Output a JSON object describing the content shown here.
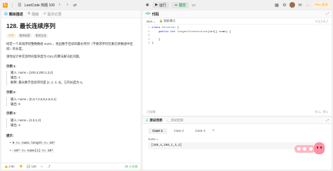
{
  "topbar": {
    "app_name": "LeetCode 热题 100",
    "submit_label": "提交",
    "run_label": "运行",
    "plus_label": "Plus 会员"
  },
  "left": {
    "tabs": [
      {
        "label": "题目描述",
        "icon": "document-icon"
      },
      {
        "label": "题解",
        "icon": "flask-icon"
      },
      {
        "label": "提交记录",
        "icon": "history-icon"
      }
    ],
    "title": "128. 最长连续序列",
    "chips": [
      {
        "label": "中等"
      },
      {
        "label": "相关标签"
      },
      {
        "label": "相关企业"
      }
    ],
    "desc1": "给定一个未排序的整数数组 nums ，找出数字连续的最长序列（不要求序列元素在原数组中连续）的长度。",
    "desc2": "请你设计并实现时间复杂度为 O(n) 的算法解决此问题。",
    "examples": [
      {
        "title": "示例 1:",
        "input": "输入: nums = [100,4,200,1,3,2]",
        "output": "输出: 4",
        "explain": "解释: 最长数字连续序列是 [1, 2, 3, 4]。它的长度为 4。"
      },
      {
        "title": "示例 2:",
        "input": "输入: nums = [0,3,7,2,5,8,4,6,0,1]",
        "output": "输出: 9"
      },
      {
        "title": "示例 3:",
        "input": "输入: nums = [1,0,1,2]",
        "output": "输出: 3"
      }
    ],
    "constraints_title": "提示:",
    "constraints": [
      "0 <= nums.length <= 10⁵",
      "-10⁹ <= nums[i] <= 10⁹"
    ],
    "bottom": {
      "likes": "2.5K",
      "comments": "130",
      "online": "29 人在线"
    }
  },
  "code": {
    "header": "代码",
    "lang": "Java",
    "mode": "智能模式",
    "lines": [
      "class Solution {",
      "    public int longestConsecutive(int[] nums) {",
      "",
      "    }",
      "}"
    ],
    "saved_label": "已存储",
    "cursor_pos": "行 1，列 1"
  },
  "test": {
    "tabs": [
      {
        "label": "测试用例"
      },
      {
        "label": "测试结果"
      }
    ],
    "cases": [
      "Case 1",
      "Case 2",
      "Case 3"
    ],
    "add_label": "+",
    "var_label": "nums =",
    "value": "[100,4,200,1,3,2]"
  }
}
